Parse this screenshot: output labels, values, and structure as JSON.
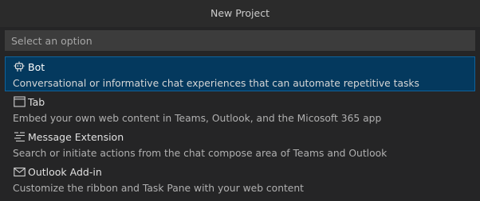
{
  "title": "New Project",
  "search": {
    "placeholder": "Select an option"
  },
  "items": [
    {
      "icon": "bot-icon",
      "label": "Bot",
      "description": "Conversational or informative chat experiences that can automate repetitive tasks",
      "selected": true
    },
    {
      "icon": "tab-icon",
      "label": "Tab",
      "description": "Embed your own web content in Teams, Outlook, and the Micosoft 365 app",
      "selected": false
    },
    {
      "icon": "message-extension-icon",
      "label": "Message Extension",
      "description": "Search or initiate actions from the chat compose area of Teams and Outlook",
      "selected": false
    },
    {
      "icon": "mail-icon",
      "label": "Outlook Add-in",
      "description": "Customize the ribbon and Task Pane with your web content",
      "selected": false
    }
  ],
  "colors": {
    "selection_background": "#04395e",
    "selection_border": "#0e639c",
    "panel_background": "#252526"
  }
}
